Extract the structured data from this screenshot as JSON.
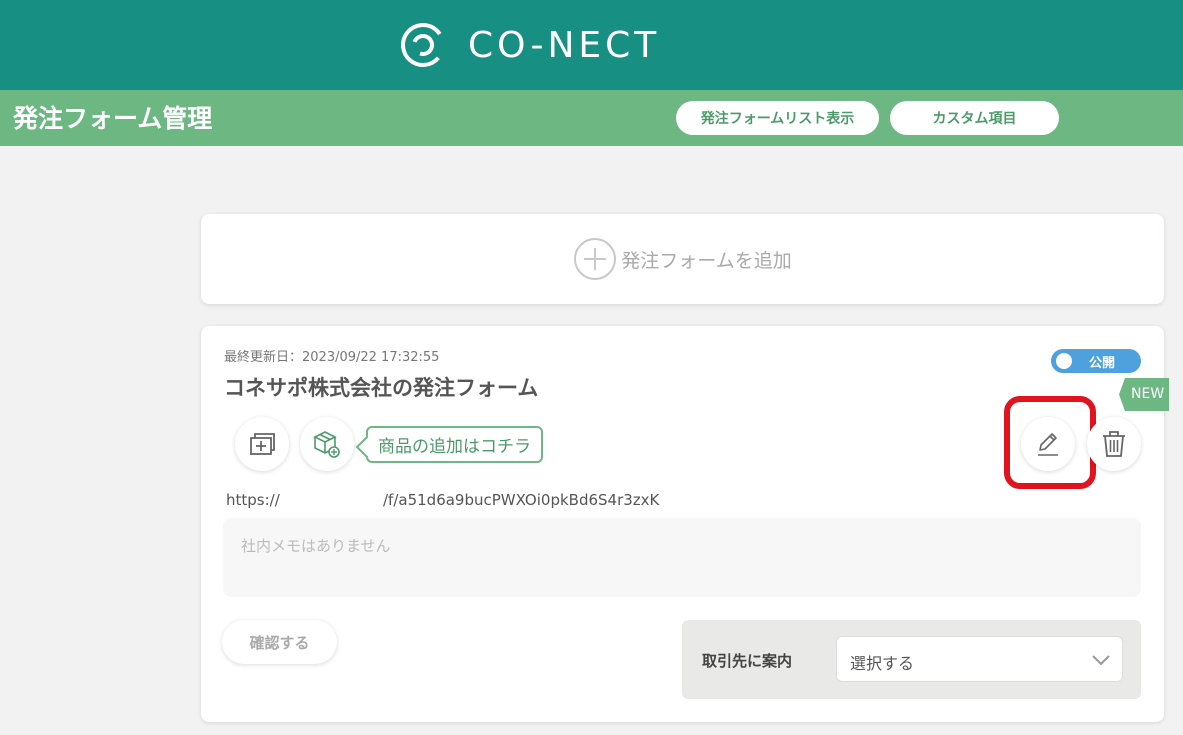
{
  "header": {
    "logo_text": "CO-NECT",
    "icon": "co-nect-logo"
  },
  "subheader": {
    "title": "発注フォーム管理",
    "list_button": "発注フォームリスト表示",
    "custom_button": "カスタム項目"
  },
  "add_form": {
    "label": "発注フォームを追加",
    "icon": "plus-circle-icon"
  },
  "form_card": {
    "updated": "最終更新日：2023/09/22 17:32:55",
    "title": "コネサポ株式会社の発注フォーム",
    "status_label": "公開",
    "status_on": true,
    "new_badge": "NEW",
    "product_callout": "商品の追加はコチラ",
    "url_prefix": "https://",
    "url_path": "/f/a51d6a9bucPWXOi0pkBd6S4r3zxK",
    "memo_placeholder": "社内メモはありません",
    "confirm_label": "確認する",
    "partner_label": "取引先に案内",
    "select_value": "選択する",
    "icons": {
      "copy": "copy-add-icon",
      "product": "product-box-add-icon",
      "edit": "pencil-edit-icon",
      "delete": "trash-icon",
      "dropdown": "chevron-down-icon"
    }
  },
  "colors": {
    "header": "#178f82",
    "subheader": "#6db783",
    "toggle": "#4ea1dd",
    "highlight": "#e0131f",
    "accent_text": "#4c9a6b"
  }
}
